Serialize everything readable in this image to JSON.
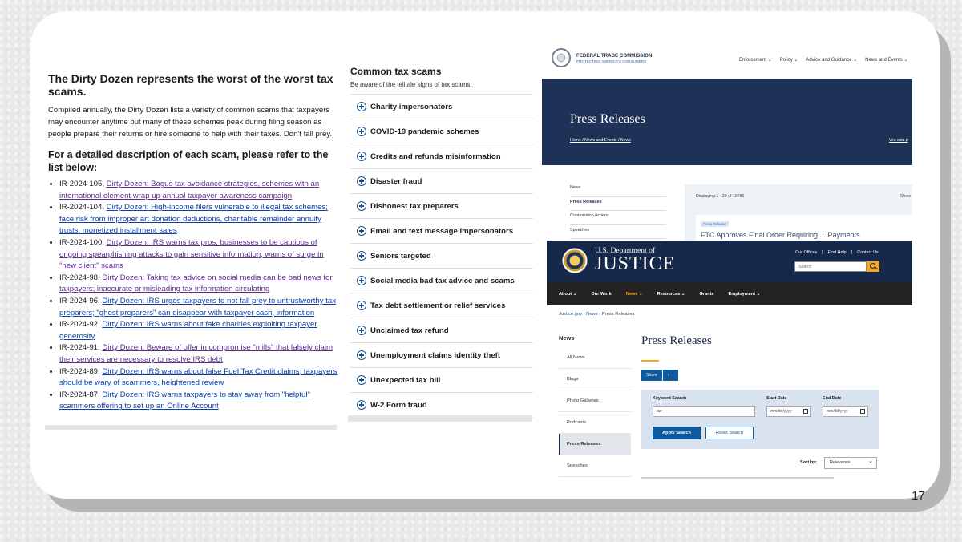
{
  "irs": {
    "heading": "The Dirty Dozen represents the worst of the worst tax scams.",
    "intro": "Compiled annually, the Dirty Dozen lists a variety of common scams that taxpayers may encounter anytime but many of these schemes peak during filing season as people prepare their returns or hire someone to help with their taxes. Don't fall prey.",
    "subheading": "For a detailed description of each scam, please refer to the list below:",
    "items": [
      {
        "id": "IR-2024-105, ",
        "link": "Dirty Dozen: Bogus tax avoidance strategies, schemes with an international element wrap up annual taxpayer awareness campaign"
      },
      {
        "id": "IR-2024-104, ",
        "link": "Dirty Dozen: High-income filers vulnerable to illegal tax schemes; face risk from improper art donation deductions, charitable remainder annuity trusts, monetized installment sales"
      },
      {
        "id": "IR-2024-100, ",
        "link": "Dirty Dozen: IRS warns tax pros, businesses to be cautious of ongoing spearphishing attacks to gain sensitive information; warns of surge in \"new client\" scams"
      },
      {
        "id": "IR-2024-98, ",
        "link": "Dirty Dozen: Taking tax advice on social media can be bad news for taxpayers; inaccurate or misleading tax information circulating"
      },
      {
        "id": "IR-2024-96, ",
        "link": "Dirty Dozen: IRS urges taxpayers to not fall prey to untrustworthy tax preparers; \"ghost preparers\" can disappear with taxpayer cash, information"
      },
      {
        "id": "IR-2024-92, ",
        "link": "Dirty Dozen: IRS warns about fake charities exploiting taxpayer generosity"
      },
      {
        "id": "IR-2024-91, ",
        "link": "Dirty Dozen: Beware of offer in compromise \"mills\" that falsely claim their services are necessary to resolve IRS debt"
      },
      {
        "id": "IR-2024-89, ",
        "link": "Dirty Dozen: IRS warns about false Fuel Tax Credit claims; taxpayers should be wary of scammers, heightened review"
      },
      {
        "id": "IR-2024-87, ",
        "link": "Dirty Dozen: IRS warns taxpayers to stay away from \"helpful\" scammers offering to set up an Online Account"
      }
    ]
  },
  "scams": {
    "title": "Common tax scams",
    "subtitle": "Be aware of the telltale signs of tax scams.",
    "items": [
      "Charity impersonators",
      "COVID-19 pandemic schemes",
      "Credits and refunds misinformation",
      "Disaster fraud",
      "Dishonest tax preparers",
      "Email and text message impersonators",
      "Seniors targeted",
      "Social media bad tax advice and scams",
      "Tax debt settlement or relief services",
      "Unclaimed tax refund",
      "Unemployment claims identity theft",
      "Unexpected tax bill",
      "W-2 Form fraud"
    ]
  },
  "ftc": {
    "name": "FEDERAL TRADE COMMISSION",
    "tagline": "PROTECTING AMERICA'S CONSUMERS",
    "nav": [
      "Enforcement ⌄",
      "Policy ⌄",
      "Advice and Guidance ⌄",
      "News and Events ⌄"
    ],
    "title": "Press Releases",
    "breadcrumb": "Home  /  News and Events  /  News",
    "visit": "Vea esta p",
    "sidebar": [
      "News",
      "Press Releases",
      "Commission Actions",
      "Speeches"
    ],
    "displaying": "Displaying 1 - 20 of 10786",
    "show": "Show",
    "pill": "Press Release",
    "headline": "FTC Approves Final Order Requiring ... Payments"
  },
  "doj": {
    "dept": "U.S. Department of",
    "justice": "JUSTICE",
    "util": [
      "Our Offices",
      "|",
      "Find Help",
      "|",
      "Contact Us"
    ],
    "search_placeholder": "Search",
    "nav": [
      "About ⌄",
      "Our Work",
      "News ⌄",
      "Resources ⌄",
      "Grants",
      "Employment ⌄"
    ],
    "bc_home": "Justice.gov",
    "bc_news": "News",
    "bc_current": "Press Releases",
    "news_heading": "News",
    "sidebar": [
      "All News",
      "Blogs",
      "Photo Galleries",
      "Podcasts",
      "Press Releases",
      "Speeches"
    ],
    "title": "Press Releases",
    "share": "Share",
    "share_chevron": "›",
    "kw_label": "Keyword Search",
    "kw_value": "tax",
    "start_label": "Start Date",
    "end_label": "End Date",
    "date_placeholder": "mm/dd/yyyy",
    "apply": "Apply Search",
    "reset": "Reset Search",
    "sort_label": "Sort by:",
    "sort_value": "Relevance"
  },
  "slide_number": "17"
}
